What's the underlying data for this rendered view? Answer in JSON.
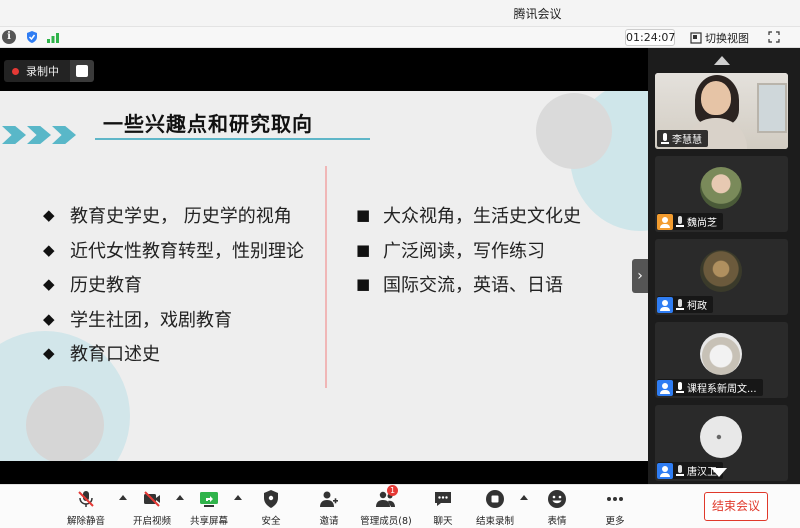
{
  "window": {
    "title": "腾讯会议"
  },
  "status_bar": {
    "timer": "01:24:07",
    "switch_view_label": "切换视图"
  },
  "recording": {
    "label": "录制中"
  },
  "slide": {
    "title": "一些兴趣点和研究取向",
    "left_items": [
      "教育史学史， 历史学的视角",
      "近代女性教育转型，性别理论",
      "历史教育",
      "学生社团，戏剧教育",
      "教育口述史"
    ],
    "right_items": [
      "大众视角，生活史文化史",
      "广泛阅读，写作练习",
      "国际交流，英语、日语"
    ],
    "left_bullet": "◆",
    "right_bullet": "■"
  },
  "gallery": {
    "participants": [
      {
        "name": "李慧慧",
        "type": "camera"
      },
      {
        "name": "魏尚芝",
        "type": "avatar"
      },
      {
        "name": "柯政",
        "type": "avatar"
      },
      {
        "name": "课程系新周文...",
        "type": "avatar"
      },
      {
        "name": "唐汉卫",
        "type": "avatar"
      }
    ]
  },
  "toolbar": {
    "unmute": "解除静音",
    "start_video": "开启视频",
    "share_screen": "共享屏幕",
    "security": "安全",
    "invite": "邀请",
    "manage_members": "管理成员(8)",
    "manage_badge": "1",
    "chat": "聊天",
    "end_recording": "结束录制",
    "reactions": "表情",
    "more": "更多",
    "end_meeting": "结束会议"
  },
  "colors": {
    "accent_teal": "#59b7c8",
    "danger_red": "#e0392b",
    "gallery_bg": "#1c1c1c",
    "slide_bg": "#eeeeee"
  }
}
